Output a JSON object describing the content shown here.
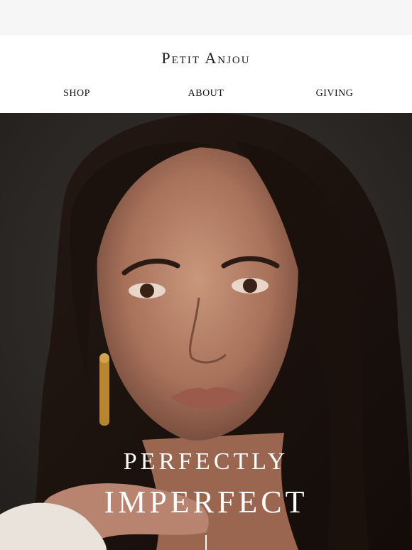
{
  "brand": {
    "name": "Petit Anjou"
  },
  "nav": {
    "items": [
      {
        "label": "SHOP"
      },
      {
        "label": "ABOUT"
      },
      {
        "label": "GIVING"
      }
    ]
  },
  "hero": {
    "headline_line1": "PERFECTLY",
    "headline_line2": "IMPERFECT"
  },
  "colors": {
    "page_background": "#f6f6f6",
    "header_background": "#ffffff",
    "hero_background": "#2d2a28",
    "text_dark": "#1a1a1a",
    "text_light": "#ffffff"
  }
}
